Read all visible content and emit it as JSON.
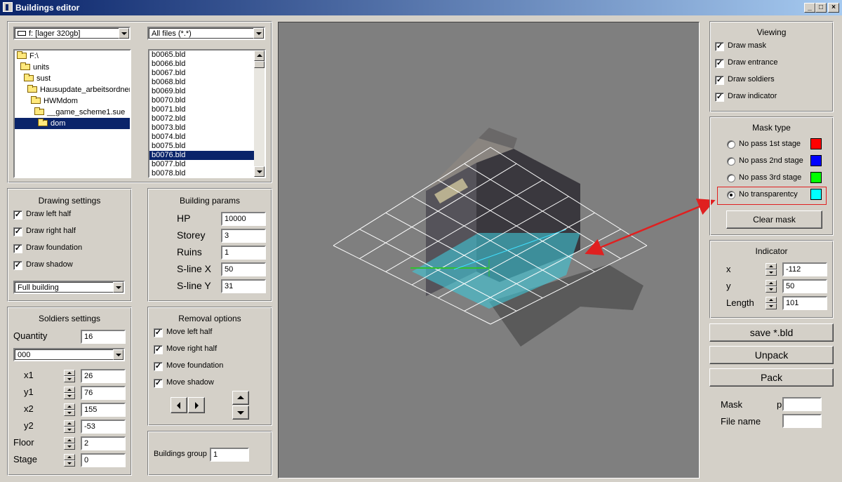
{
  "window": {
    "title": "Buildings editor"
  },
  "drive": {
    "selected": "f: [lager 320gb]"
  },
  "filter": {
    "selected": "All files (*.*)"
  },
  "folders": [
    {
      "label": "F:\\",
      "indent": 0,
      "selected": false
    },
    {
      "label": "units",
      "indent": 1,
      "selected": false
    },
    {
      "label": "sust",
      "indent": 2,
      "selected": false
    },
    {
      "label": "Hausupdate_arbeitsordner",
      "indent": 3,
      "selected": false
    },
    {
      "label": "HWMdom",
      "indent": 4,
      "selected": false
    },
    {
      "label": "__game_scheme1.sue",
      "indent": 5,
      "selected": false
    },
    {
      "label": "dom",
      "indent": 6,
      "selected": true
    }
  ],
  "files": [
    "b0065.bld",
    "b0066.bld",
    "b0067.bld",
    "b0068.bld",
    "b0069.bld",
    "b0070.bld",
    "b0071.bld",
    "b0072.bld",
    "b0073.bld",
    "b0074.bld",
    "b0075.bld",
    "b0076.bld",
    "b0077.bld",
    "b0078.bld"
  ],
  "selected_file_index": 11,
  "drawing": {
    "title": "Drawing settings",
    "left_half": "Draw left half",
    "right_half": "Draw right half",
    "foundation": "Draw foundation",
    "shadow": "Draw shadow",
    "mode": "Full building"
  },
  "params": {
    "title": "Building params",
    "hp_label": "HP",
    "hp": "10000",
    "storey_label": "Storey",
    "storey": "3",
    "ruins_label": "Ruins",
    "ruins": "1",
    "slx_label": "S-line X",
    "slx": "50",
    "sly_label": "S-line Y",
    "sly": "31"
  },
  "soldiers": {
    "title": "Soldiers settings",
    "quantity_label": "Quantity",
    "quantity": "16",
    "preset": "000",
    "x1_label": "x1",
    "x1": "26",
    "y1_label": "y1",
    "y1": "76",
    "x2_label": "x2",
    "x2": "155",
    "y2_label": "y2",
    "y2": "-53",
    "floor_label": "Floor",
    "floor": "2",
    "stage_label": "Stage",
    "stage": "0"
  },
  "removal": {
    "title": "Removal options",
    "left": "Move left half",
    "right": "Move right half",
    "foundation": "Move foundation",
    "shadow": "Move shadow"
  },
  "group": {
    "label": "Buildings group",
    "value": "1"
  },
  "viewing": {
    "title": "Viewing",
    "mask": "Draw mask",
    "entrance": "Draw entrance",
    "soldiers": "Draw soldiers",
    "indicator": "Draw indicator"
  },
  "mask_type": {
    "title": "Mask type",
    "options": [
      {
        "label": "No pass 1st stage",
        "color": "#ff0000"
      },
      {
        "label": "No pass 2nd stage",
        "color": "#0000ff"
      },
      {
        "label": "No pass 3rd stage",
        "color": "#00ff00"
      },
      {
        "label": "No transparentcy",
        "color": "#00ffff"
      }
    ],
    "selected_index": 3,
    "clear": "Clear mask"
  },
  "indicator": {
    "title": "Indicator",
    "x_label": "x",
    "x": "-112",
    "y_label": "y",
    "y": "50",
    "length_label": "Length",
    "length": "101"
  },
  "actions": {
    "save": "save *.bld",
    "unpack": "Unpack",
    "pack": "Pack"
  },
  "info": {
    "mask_label": "Mask",
    "mask_prefix": "p",
    "mask_value": "",
    "filename_label": "File name",
    "filename_value": ""
  },
  "annotation_color": "#e02020"
}
